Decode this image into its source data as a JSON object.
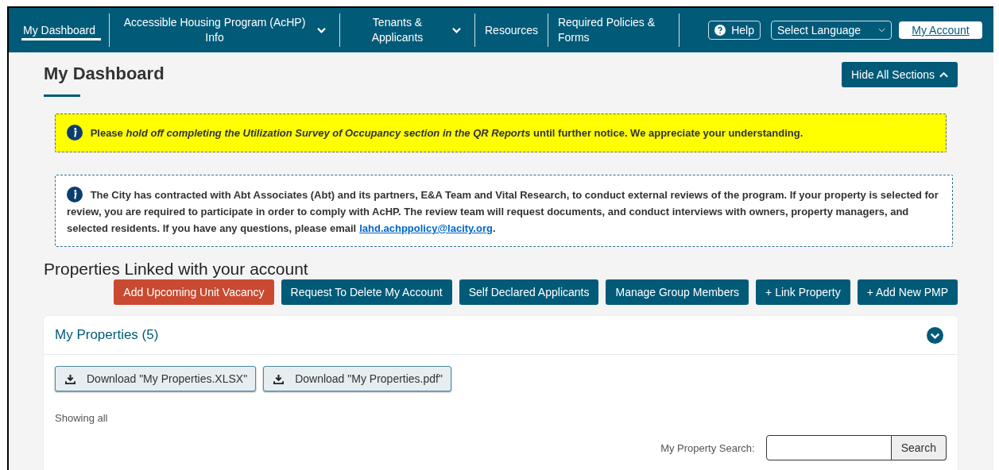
{
  "nav": {
    "items": [
      {
        "label": "My Dashboard",
        "selected": true,
        "dropdown": false
      },
      {
        "label": "Accessible Housing Program (AcHP) Info",
        "selected": false,
        "dropdown": true
      },
      {
        "label": "Tenants & Applicants",
        "selected": false,
        "dropdown": true
      },
      {
        "label": "Resources",
        "selected": false,
        "dropdown": false
      },
      {
        "label": "Required Policies & Forms",
        "selected": false,
        "dropdown": false
      }
    ],
    "help": "Help",
    "language": "Select Language",
    "account": "My Account"
  },
  "page_title": "My Dashboard",
  "hide_button": "Hide All Sections",
  "notices": [
    {
      "kind": "warning",
      "text": "Please *hold off completing the Utilization Survey of Occupancy section in the QR Reports* until further notice. We appreciate your understanding."
    },
    {
      "kind": "info",
      "text": "The City has contracted with Abt Associates (Abt) and its partners, E&A Team and Vital Research, to conduct external reviews of the program. If your property is selected for review, you are required to participate in order to comply with AcHP. The review team will request documents, and conduct interviews with owners, property managers, and selected residents. If you have any questions, please email",
      "link": "lahd.achppolicy@lacity.org",
      "after": "."
    }
  ],
  "section_title": "Properties Linked with your account",
  "actions": [
    {
      "label": "Add Upcoming Unit Vacancy",
      "kind": "danger"
    },
    {
      "label": "Request To Delete My Account",
      "kind": "primary"
    },
    {
      "label": "Self Declared Applicants",
      "kind": "primary"
    },
    {
      "label": "Manage Group Members",
      "kind": "primary"
    },
    {
      "label": "+ Link Property",
      "kind": "primary"
    },
    {
      "label": "+ Add New PMP",
      "kind": "primary"
    }
  ],
  "properties": {
    "title": "My Properties (5)",
    "expanded": true,
    "downloads": [
      "Download \"My Properties.XLSX\"",
      "Download \"My Properties.pdf\""
    ],
    "showing": "Showing all",
    "search_label": "My Property Search:",
    "search_button": "Search"
  }
}
